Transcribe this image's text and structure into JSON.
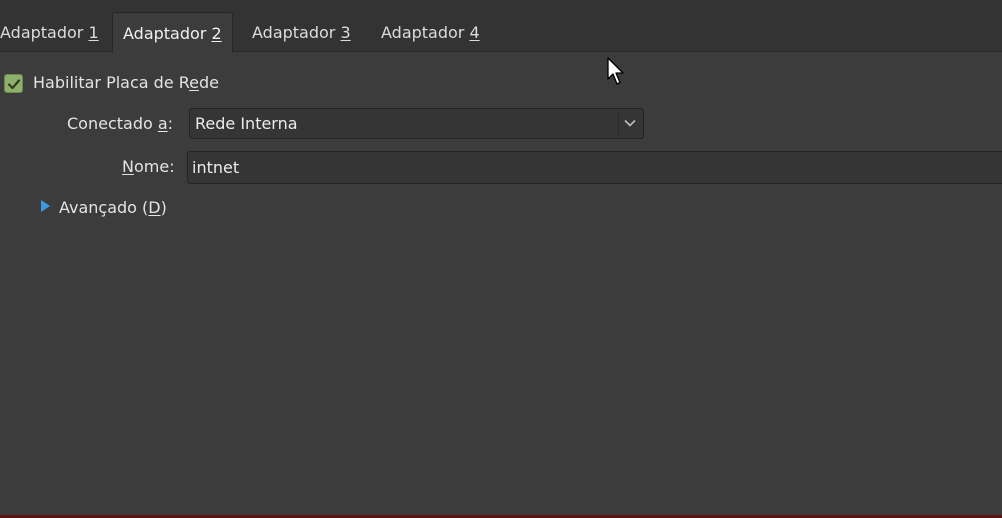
{
  "tabs": [
    {
      "prefix": "Adaptador ",
      "key": "1",
      "active": false
    },
    {
      "prefix": "Adaptador ",
      "key": "2",
      "active": true
    },
    {
      "prefix": "Adaptador ",
      "key": "3",
      "active": false
    },
    {
      "prefix": "Adaptador ",
      "key": "4",
      "active": false
    }
  ],
  "enable": {
    "label_pre": "Habilitar Placa de R",
    "label_key": "e",
    "label_post": "de",
    "checked": true,
    "check_color": "#8fb06a"
  },
  "attached": {
    "label_pre": "Conectado ",
    "label_key": "a",
    "label_post": ":",
    "value": "Rede Interna"
  },
  "name": {
    "label_key": "N",
    "label_post": "ome:",
    "value": "intnet"
  },
  "advanced": {
    "label_pre": "Avançado (",
    "label_key": "D",
    "label_post": ")",
    "arrow_color": "#3a9be0"
  }
}
